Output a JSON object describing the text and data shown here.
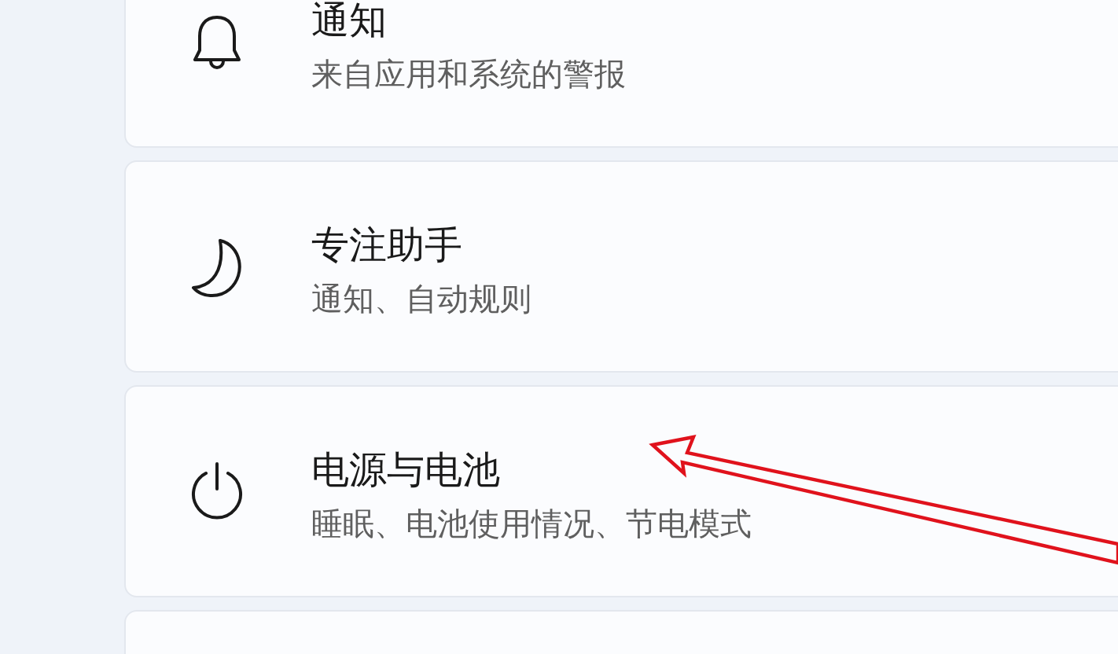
{
  "settings_items": [
    {
      "kind": "bell",
      "title": "通知",
      "subtitle": "来自应用和系统的警报"
    },
    {
      "kind": "moon",
      "title": "专注助手",
      "subtitle": "通知、自动规则"
    },
    {
      "kind": "power",
      "title": "电源与电池",
      "subtitle": "睡眠、电池使用情况、节电模式"
    }
  ]
}
